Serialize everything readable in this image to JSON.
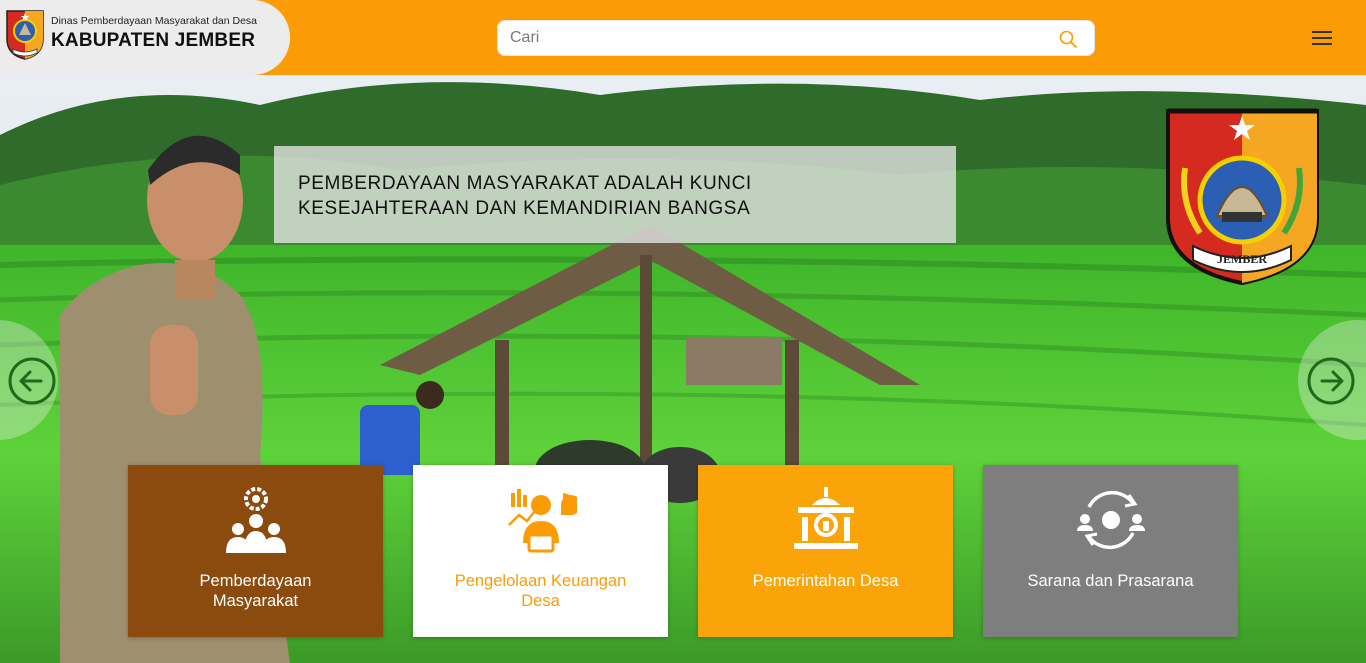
{
  "header": {
    "agency": "Dinas Pemberdayaan Masyarakat dan Desa",
    "region": "KABUPATEN JEMBER",
    "logo_icon": "jember-crest-icon",
    "menu_icon": "hamburger-menu-icon"
  },
  "search": {
    "placeholder": "Cari",
    "value": "",
    "icon": "search-icon"
  },
  "hero": {
    "tagline_line1": "PEMBERDAYAAN MASYARAKAT ADALAH KUNCI",
    "tagline_line2": "KESEJAHTERAAN DAN KEMANDIRIAN BANGSA",
    "crest_text": "JEMBER",
    "prev_icon": "arrow-left-circle-icon",
    "next_icon": "arrow-right-circle-icon"
  },
  "cards": [
    {
      "line1": "Pemberdayaan",
      "line2": "Masyarakat",
      "icon": "community-gear-icon",
      "bg": "#8b4a0e"
    },
    {
      "line1": "Pengelolaan Keuangan",
      "line2": "Desa",
      "icon": "finance-analytics-icon",
      "bg": "#ffffff"
    },
    {
      "line1": "Pemerintahan Desa",
      "line2": "",
      "icon": "government-building-icon",
      "bg": "#fba40a"
    },
    {
      "line1": "Sarana dan Prasarana",
      "line2": "",
      "icon": "infrastructure-cycle-icon",
      "bg": "#7e7e7e"
    }
  ],
  "colors": {
    "accent": "#fb9c06",
    "brown": "#8b4a0e",
    "grey": "#7e7e7e"
  }
}
